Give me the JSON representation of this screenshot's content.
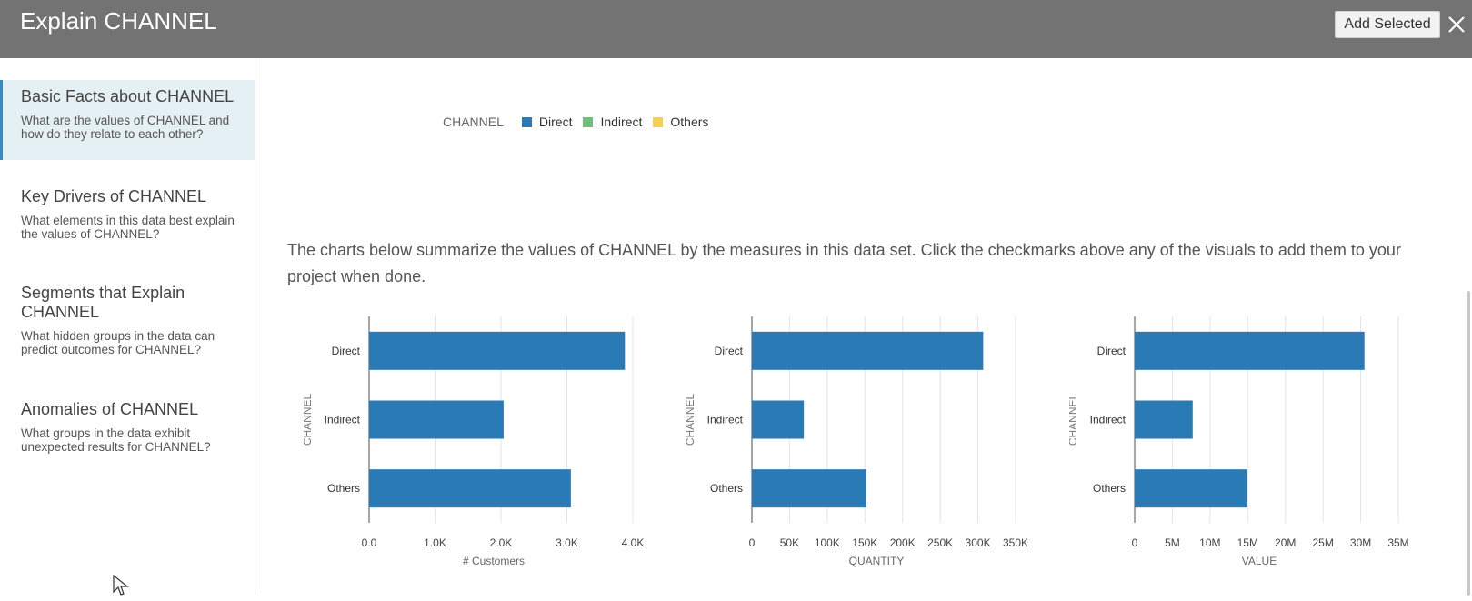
{
  "header": {
    "title": "Explain CHANNEL",
    "add_button": "Add Selected",
    "close_icon": "close-icon",
    "background_color": "#737373"
  },
  "sidebar": {
    "items": [
      {
        "title": "Basic Facts about CHANNEL",
        "description": "What are the values of CHANNEL and how do they relate to each other?",
        "active": true
      },
      {
        "title": "Key Drivers of CHANNEL",
        "description": "What elements in this data best explain the values of CHANNEL?",
        "active": false
      },
      {
        "title": "Segments that Explain CHANNEL",
        "description": "What hidden groups in the data can predict outcomes for CHANNEL?",
        "active": false
      },
      {
        "title": "Anomalies of CHANNEL",
        "description": "What groups in the data exhibit unexpected results for CHANNEL?",
        "active": false
      }
    ]
  },
  "legend": {
    "title": "CHANNEL",
    "items": [
      {
        "label": "Direct",
        "color": "#2a7ab5"
      },
      {
        "label": "Indirect",
        "color": "#6cc07a"
      },
      {
        "label": "Others",
        "color": "#f5cf4f"
      }
    ]
  },
  "intro_text": "The charts below summarize the values of CHANNEL by the measures in this data set. Click the checkmarks above any of the visuals to add them to your project when done.",
  "chart_data": [
    {
      "type": "bar",
      "orientation": "horizontal",
      "categories": [
        "Direct",
        "Indirect",
        "Others"
      ],
      "values": [
        3880,
        2040,
        3060
      ],
      "ylabel": "CHANNEL",
      "xlabel": "# Customers",
      "xlim": [
        0,
        4000
      ],
      "ticks": [
        0,
        1000,
        2000,
        3000,
        4000
      ],
      "tick_labels": [
        "0.0",
        "1.0K",
        "2.0K",
        "3.0K",
        "4.0K"
      ],
      "bar_color": "#2a7ab5",
      "grid": true
    },
    {
      "type": "bar",
      "orientation": "horizontal",
      "categories": [
        "Direct",
        "Indirect",
        "Others"
      ],
      "values": [
        307000,
        69000,
        152000
      ],
      "ylabel": "CHANNEL",
      "xlabel": "QUANTITY",
      "xlim": [
        0,
        350000
      ],
      "ticks": [
        0,
        50000,
        100000,
        150000,
        200000,
        250000,
        300000,
        350000
      ],
      "tick_labels": [
        "0",
        "50K",
        "100K",
        "150K",
        "200K",
        "250K",
        "300K",
        "350K"
      ],
      "bar_color": "#2a7ab5",
      "grid": true
    },
    {
      "type": "bar",
      "orientation": "horizontal",
      "categories": [
        "Direct",
        "Indirect",
        "Others"
      ],
      "values": [
        30500000,
        7700000,
        14900000
      ],
      "ylabel": "CHANNEL",
      "xlabel": "VALUE",
      "xlim": [
        0,
        35000000
      ],
      "ticks": [
        0,
        5000000,
        10000000,
        15000000,
        20000000,
        25000000,
        30000000,
        35000000
      ],
      "tick_labels": [
        "0",
        "5M",
        "10M",
        "15M",
        "20M",
        "25M",
        "30M",
        "35M"
      ],
      "bar_color": "#2a7ab5",
      "grid": true
    }
  ]
}
